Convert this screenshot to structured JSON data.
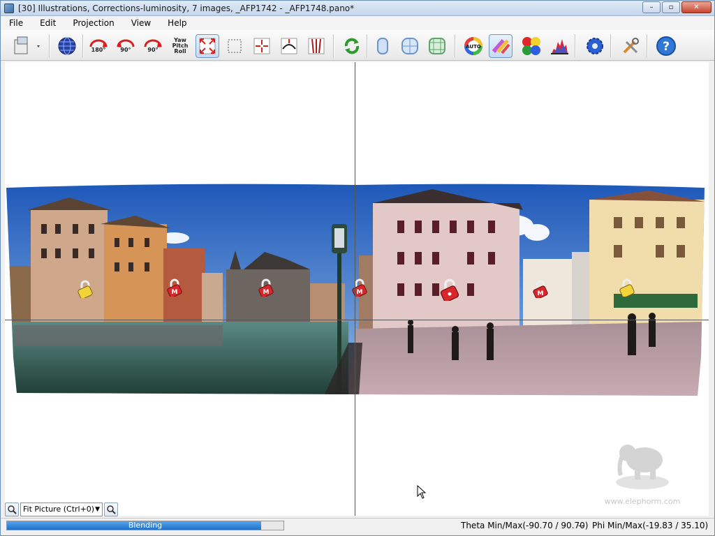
{
  "window": {
    "title": "[30] Illustrations, Corrections-luminosity, 7 images, _AFP1742 - _AFP1748.pano*",
    "controls": {
      "minimize": "–",
      "maximize": "▫",
      "close": "✕"
    }
  },
  "menu": [
    "File",
    "Edit",
    "Projection",
    "View",
    "Help"
  ],
  "toolbar": {
    "rotate_180": "180°",
    "rotate_ccw": "90°",
    "rotate_cw": "90°",
    "ypr": [
      "Yaw",
      "Pitch",
      "Roll"
    ],
    "auto": "AUTO",
    "icons": [
      "file-open-icon",
      "globe-icon",
      "rotate-180-icon",
      "rotate-ccw-90-icon",
      "rotate-cw-90-icon",
      "yaw-pitch-roll-icon",
      "fit-full-icon",
      "crop-icon",
      "center-icon",
      "straighten-icon",
      "vertical-lines-icon",
      "refresh-icon",
      "projection-cylinder-icon",
      "projection-sphere-icon",
      "projection-mesh-icon",
      "auto-color-icon",
      "color-blend-icon",
      "color-circles-icon",
      "histogram-icon",
      "settings-gear-icon",
      "tools-icon",
      "help-icon"
    ]
  },
  "canvas": {
    "watermark": "www.elephorm.com"
  },
  "zoom": {
    "selected": "Fit Picture (Ctrl+0)"
  },
  "status": {
    "progress_label": "Blending",
    "progress_percent": 92,
    "theta": "Theta Min/Max(-90.70 / 90.70)",
    "separator": "--",
    "phi": "Phi Min/Max(-19.83 / 35.10)"
  },
  "colors": {
    "accent": "#2a7ad0",
    "lock_red": "#d8262b",
    "lock_yellow": "#f2d43a"
  }
}
